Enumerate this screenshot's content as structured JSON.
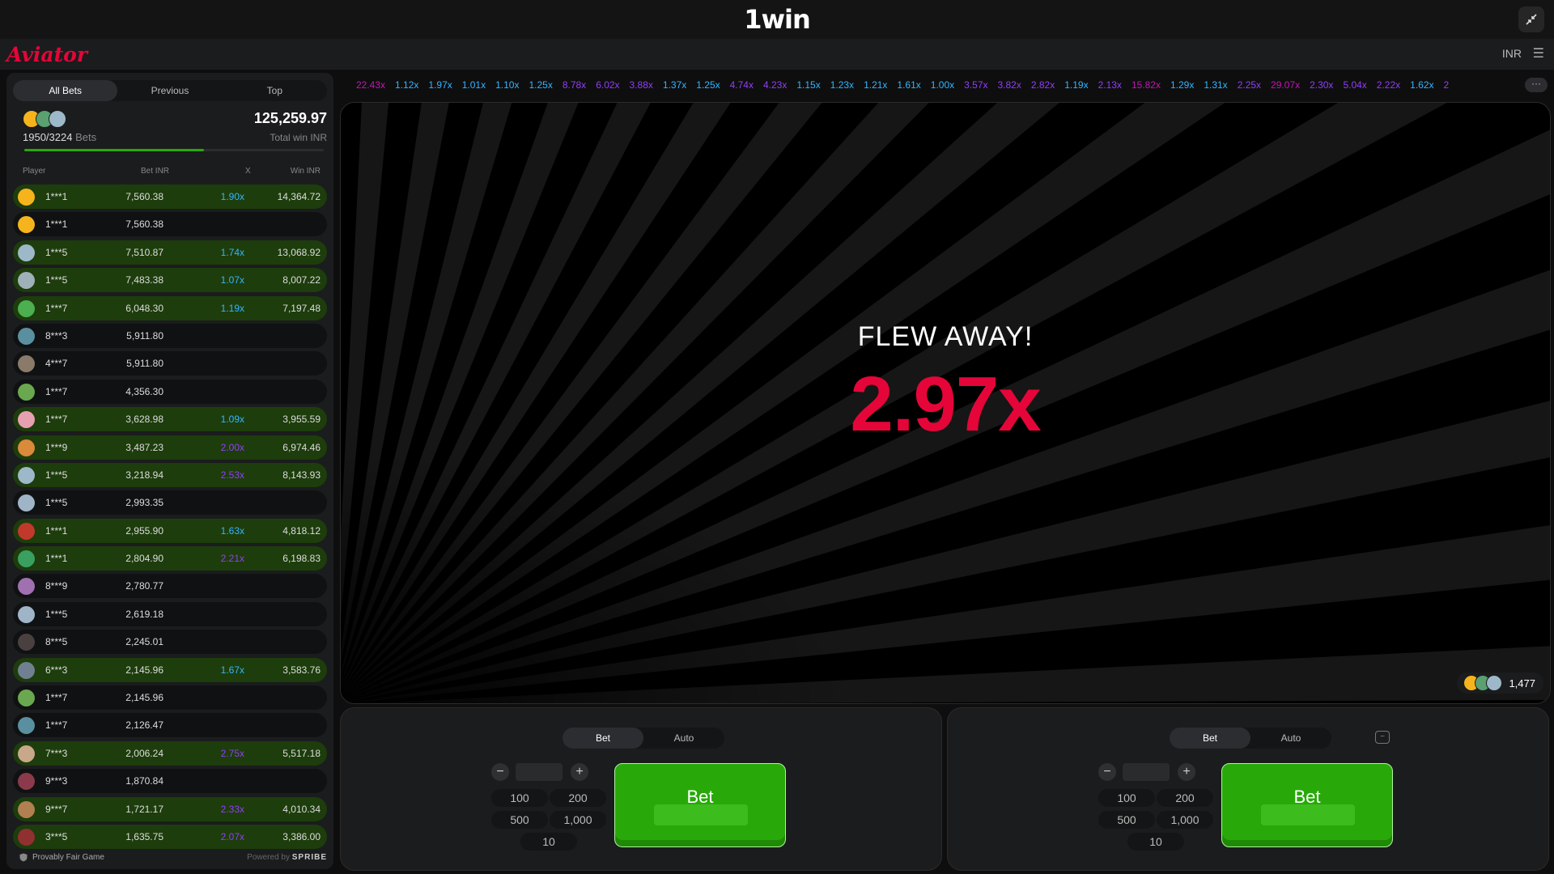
{
  "header": {
    "brand": "1win",
    "app_name": "Aviator",
    "currency": "INR"
  },
  "left_panel": {
    "tabs": [
      {
        "label": "All Bets",
        "active": true
      },
      {
        "label": "Previous",
        "active": false
      },
      {
        "label": "Top",
        "active": false
      }
    ],
    "bets_count": "1950/3224",
    "bets_label": "Bets",
    "total_win": "125,259.97",
    "total_win_label": "Total win INR",
    "progress_fraction": 0.6,
    "columns": {
      "player": "Player",
      "bet": "Bet INR",
      "x": "X",
      "win": "Win INR"
    },
    "rows": [
      {
        "player": "1***1",
        "bet": "7,560.38",
        "x": "1.90x",
        "win": "14,364.72",
        "won": true,
        "xcolor": "#34b4ff",
        "avatar": "#f5b41c"
      },
      {
        "player": "1***1",
        "bet": "7,560.38",
        "x": "",
        "win": "",
        "won": false,
        "xcolor": "",
        "avatar": "#f5b41c"
      },
      {
        "player": "1***5",
        "bet": "7,510.87",
        "x": "1.74x",
        "win": "13,068.92",
        "won": true,
        "xcolor": "#34b4ff",
        "avatar": "#9db8c8"
      },
      {
        "player": "1***5",
        "bet": "7,483.38",
        "x": "1.07x",
        "win": "8,007.22",
        "won": true,
        "xcolor": "#34b4ff",
        "avatar": "#a0b0b8"
      },
      {
        "player": "1***7",
        "bet": "6,048.30",
        "x": "1.19x",
        "win": "7,197.48",
        "won": true,
        "xcolor": "#34b4ff",
        "avatar": "#4caf50"
      },
      {
        "player": "8***3",
        "bet": "5,911.80",
        "x": "",
        "win": "",
        "won": false,
        "xcolor": "",
        "avatar": "#5a8fa0"
      },
      {
        "player": "4***7",
        "bet": "5,911.80",
        "x": "",
        "win": "",
        "won": false,
        "xcolor": "",
        "avatar": "#8a7a6a"
      },
      {
        "player": "1***7",
        "bet": "4,356.30",
        "x": "",
        "win": "",
        "won": false,
        "xcolor": "",
        "avatar": "#6aa84f"
      },
      {
        "player": "1***7",
        "bet": "3,628.98",
        "x": "1.09x",
        "win": "3,955.59",
        "won": true,
        "xcolor": "#34b4ff",
        "avatar": "#e7a0b0"
      },
      {
        "player": "1***9",
        "bet": "3,487.23",
        "x": "2.00x",
        "win": "6,974.46",
        "won": true,
        "xcolor": "#913ef8",
        "avatar": "#d98a3a"
      },
      {
        "player": "1***5",
        "bet": "3,218.94",
        "x": "2.53x",
        "win": "8,143.93",
        "won": true,
        "xcolor": "#913ef8",
        "avatar": "#9db8c8"
      },
      {
        "player": "1***5",
        "bet": "2,993.35",
        "x": "",
        "win": "",
        "won": false,
        "xcolor": "",
        "avatar": "#a0b4c8"
      },
      {
        "player": "1***1",
        "bet": "2,955.90",
        "x": "1.63x",
        "win": "4,818.12",
        "won": true,
        "xcolor": "#34b4ff",
        "avatar": "#c0392b"
      },
      {
        "player": "1***1",
        "bet": "2,804.90",
        "x": "2.21x",
        "win": "6,198.83",
        "won": true,
        "xcolor": "#913ef8",
        "avatar": "#3aa060"
      },
      {
        "player": "8***9",
        "bet": "2,780.77",
        "x": "",
        "win": "",
        "won": false,
        "xcolor": "",
        "avatar": "#a070b0"
      },
      {
        "player": "1***5",
        "bet": "2,619.18",
        "x": "",
        "win": "",
        "won": false,
        "xcolor": "",
        "avatar": "#a0b4c8"
      },
      {
        "player": "8***5",
        "bet": "2,245.01",
        "x": "",
        "win": "",
        "won": false,
        "xcolor": "",
        "avatar": "#4a4040"
      },
      {
        "player": "6***3",
        "bet": "2,145.96",
        "x": "1.67x",
        "win": "3,583.76",
        "won": true,
        "xcolor": "#34b4ff",
        "avatar": "#708090"
      },
      {
        "player": "1***7",
        "bet": "2,145.96",
        "x": "",
        "win": "",
        "won": false,
        "xcolor": "",
        "avatar": "#6aa84f"
      },
      {
        "player": "1***7",
        "bet": "2,126.47",
        "x": "",
        "win": "",
        "won": false,
        "xcolor": "",
        "avatar": "#5a8fa0"
      },
      {
        "player": "7***3",
        "bet": "2,006.24",
        "x": "2.75x",
        "win": "5,517.18",
        "won": true,
        "xcolor": "#913ef8",
        "avatar": "#c8a888"
      },
      {
        "player": "9***3",
        "bet": "1,870.84",
        "x": "",
        "win": "",
        "won": false,
        "xcolor": "",
        "avatar": "#8a3a4a"
      },
      {
        "player": "9***7",
        "bet": "1,721.17",
        "x": "2.33x",
        "win": "4,010.34",
        "won": true,
        "xcolor": "#913ef8",
        "avatar": "#b08050"
      },
      {
        "player": "3***5",
        "bet": "1,635.75",
        "x": "2.07x",
        "win": "3,386.00",
        "won": true,
        "xcolor": "#913ef8",
        "avatar": "#903030"
      }
    ],
    "footer": {
      "provably_fair": "Provably Fair Game",
      "powered_by": "Powered by",
      "provider": "SPRIBE"
    }
  },
  "history": [
    {
      "v": "22.43x",
      "c": "#c017b4"
    },
    {
      "v": "1.12x",
      "c": "#34b4ff"
    },
    {
      "v": "1.97x",
      "c": "#34b4ff"
    },
    {
      "v": "1.01x",
      "c": "#34b4ff"
    },
    {
      "v": "1.10x",
      "c": "#34b4ff"
    },
    {
      "v": "1.25x",
      "c": "#34b4ff"
    },
    {
      "v": "8.78x",
      "c": "#913ef8"
    },
    {
      "v": "6.02x",
      "c": "#913ef8"
    },
    {
      "v": "3.88x",
      "c": "#913ef8"
    },
    {
      "v": "1.37x",
      "c": "#34b4ff"
    },
    {
      "v": "1.25x",
      "c": "#34b4ff"
    },
    {
      "v": "4.74x",
      "c": "#913ef8"
    },
    {
      "v": "4.23x",
      "c": "#913ef8"
    },
    {
      "v": "1.15x",
      "c": "#34b4ff"
    },
    {
      "v": "1.23x",
      "c": "#34b4ff"
    },
    {
      "v": "1.21x",
      "c": "#34b4ff"
    },
    {
      "v": "1.61x",
      "c": "#34b4ff"
    },
    {
      "v": "1.00x",
      "c": "#34b4ff"
    },
    {
      "v": "3.57x",
      "c": "#913ef8"
    },
    {
      "v": "3.82x",
      "c": "#913ef8"
    },
    {
      "v": "2.82x",
      "c": "#913ef8"
    },
    {
      "v": "1.19x",
      "c": "#34b4ff"
    },
    {
      "v": "2.13x",
      "c": "#913ef8"
    },
    {
      "v": "15.82x",
      "c": "#c017b4"
    },
    {
      "v": "1.29x",
      "c": "#34b4ff"
    },
    {
      "v": "1.31x",
      "c": "#34b4ff"
    },
    {
      "v": "2.25x",
      "c": "#913ef8"
    },
    {
      "v": "29.07x",
      "c": "#c017b4"
    },
    {
      "v": "2.30x",
      "c": "#913ef8"
    },
    {
      "v": "5.04x",
      "c": "#913ef8"
    },
    {
      "v": "2.22x",
      "c": "#913ef8"
    },
    {
      "v": "1.62x",
      "c": "#34b4ff"
    },
    {
      "v": "2",
      "c": "#913ef8"
    }
  ],
  "game": {
    "status": "FLEW AWAY!",
    "multiplier": "2.97x",
    "online_count": "1,477"
  },
  "bet_panels": [
    {
      "tabs": [
        "Bet",
        "Auto"
      ],
      "amount": "",
      "quick": [
        "100",
        "200",
        "500",
        "1,000",
        "10"
      ],
      "button": "Bet"
    },
    {
      "tabs": [
        "Bet",
        "Auto"
      ],
      "amount": "",
      "quick": [
        "100",
        "200",
        "500",
        "1,000",
        "10"
      ],
      "button": "Bet"
    }
  ],
  "colors": {
    "accent": "#e50539",
    "win_row": "#1d3d0c",
    "bet_green": "#28a909",
    "low_mult": "#34b4ff",
    "mid_mult": "#913ef8",
    "high_mult": "#c017b4"
  }
}
